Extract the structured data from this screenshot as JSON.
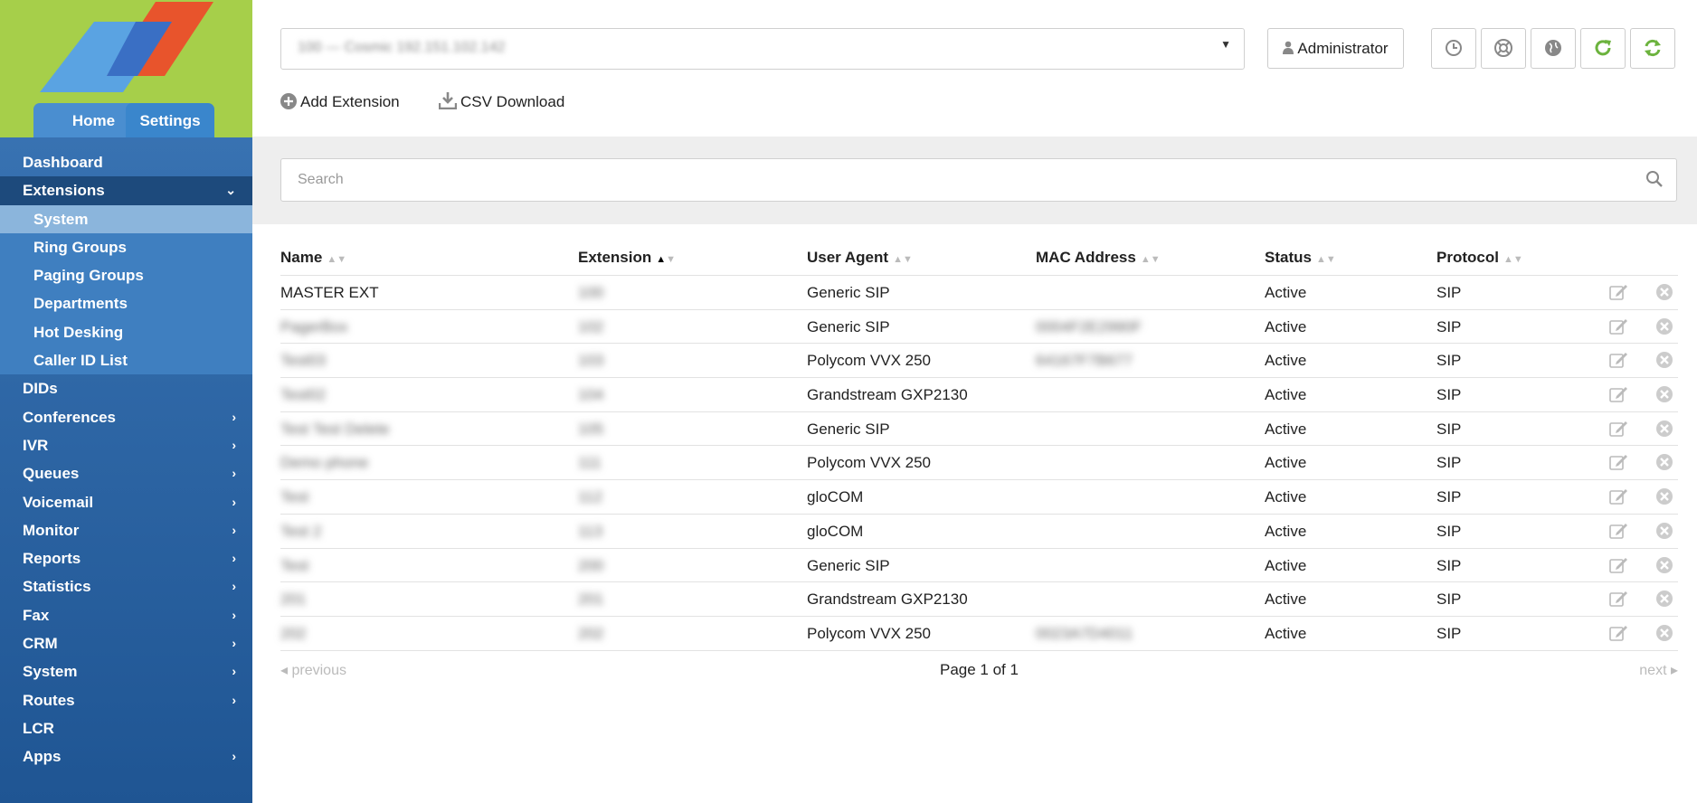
{
  "sidebar": {
    "tabs": [
      "Home",
      "Settings"
    ],
    "nav_items": [
      {
        "label": "Dashboard",
        "chevron": false
      },
      {
        "label": "Extensions",
        "chevron": true
      },
      {
        "label": "DIDs",
        "chevron": false
      },
      {
        "label": "Conferences",
        "chevron": true
      },
      {
        "label": "IVR",
        "chevron": true
      },
      {
        "label": "Queues",
        "chevron": true
      },
      {
        "label": "Voicemail",
        "chevron": true
      },
      {
        "label": "Monitor",
        "chevron": true
      },
      {
        "label": "Reports",
        "chevron": true
      },
      {
        "label": "Statistics",
        "chevron": true
      },
      {
        "label": "Fax",
        "chevron": true
      },
      {
        "label": "CRM",
        "chevron": true
      },
      {
        "label": "System",
        "chevron": true
      },
      {
        "label": "Routes",
        "chevron": true
      },
      {
        "label": "LCR",
        "chevron": false
      },
      {
        "label": "Apps",
        "chevron": true
      }
    ],
    "sub_items": [
      "System",
      "Ring Groups",
      "Paging Groups",
      "Departments",
      "Hot Desking",
      "Caller ID List"
    ],
    "colors": {
      "logo_bg": "#a6cf4a",
      "nav_bg": "#2e6aaa",
      "active_bg": "#1d4a7c",
      "sub_active_bg": "#8bb5dc"
    }
  },
  "topbar": {
    "domain_select_value": "100 — Cosmic 192.151.102.142",
    "admin_label": "Administrator",
    "icon_buttons": [
      "clock-icon",
      "lifebuoy-icon",
      "globe-icon",
      "refresh-icon",
      "sync-icon"
    ]
  },
  "actions": {
    "add_extension": "Add Extension",
    "csv_download": "CSV Download"
  },
  "search": {
    "placeholder": "Search"
  },
  "table": {
    "columns": [
      "Name",
      "Extension",
      "User Agent",
      "MAC Address",
      "Status",
      "Protocol"
    ],
    "rows": [
      {
        "name": "MASTER EXT",
        "ext": "100",
        "agent": "Generic SIP",
        "mac": "",
        "status": "Active",
        "protocol": "SIP"
      },
      {
        "name": "PagerBox",
        "ext": "102",
        "agent": "Generic SIP",
        "mac": "0004F2E2990F",
        "status": "Active",
        "protocol": "SIP"
      },
      {
        "name": "Test03",
        "ext": "103",
        "agent": "Polycom VVX 250",
        "mac": "64167F7B677",
        "status": "Active",
        "protocol": "SIP"
      },
      {
        "name": "Test02",
        "ext": "104",
        "agent": "Grandstream GXP2130",
        "mac": "",
        "status": "Active",
        "protocol": "SIP"
      },
      {
        "name": "Test Test Delete",
        "ext": "105",
        "agent": "Generic SIP",
        "mac": "",
        "status": "Active",
        "protocol": "SIP"
      },
      {
        "name": "Demo phone",
        "ext": "111",
        "agent": "Polycom VVX 250",
        "mac": "",
        "status": "Active",
        "protocol": "SIP"
      },
      {
        "name": "Test",
        "ext": "112",
        "agent": "gloCOM",
        "mac": "",
        "status": "Active",
        "protocol": "SIP"
      },
      {
        "name": "Test 2",
        "ext": "113",
        "agent": "gloCOM",
        "mac": "",
        "status": "Active",
        "protocol": "SIP"
      },
      {
        "name": "Test",
        "ext": "200",
        "agent": "Generic SIP",
        "mac": "",
        "status": "Active",
        "protocol": "SIP"
      },
      {
        "name": "201",
        "ext": "201",
        "agent": "Grandstream GXP2130",
        "mac": "",
        "status": "Active",
        "protocol": "SIP"
      },
      {
        "name": "202",
        "ext": "202",
        "agent": "Polycom VVX 250",
        "mac": "0023A7D4011",
        "status": "Active",
        "protocol": "SIP"
      }
    ]
  },
  "pager": {
    "previous": "previous",
    "page": "Page 1 of 1",
    "next": "next"
  }
}
